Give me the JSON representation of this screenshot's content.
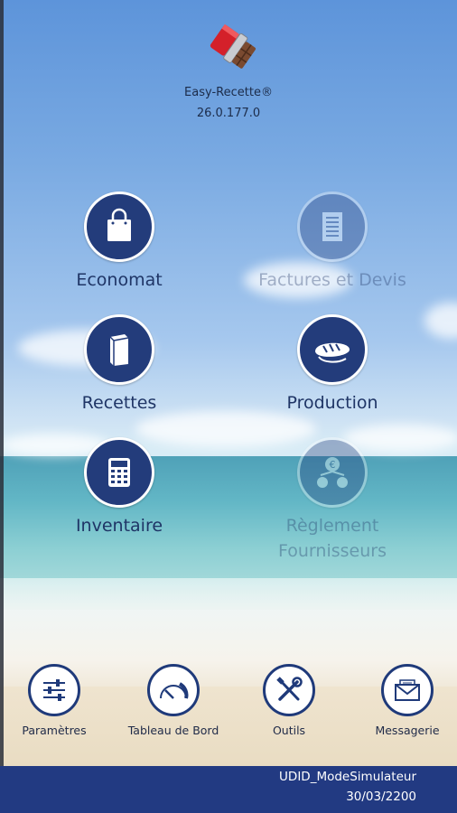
{
  "app": {
    "name": "Easy-Recette®",
    "version": "26.0.177.0"
  },
  "tiles": [
    {
      "label": "Economat",
      "icon": "shopping-bag-icon",
      "enabled": true
    },
    {
      "label": "Factures et Devis",
      "icon": "document-icon",
      "enabled": false
    },
    {
      "label": "Recettes",
      "icon": "book-icon",
      "enabled": true
    },
    {
      "label": "Production",
      "icon": "bread-icon",
      "enabled": true
    },
    {
      "label": "Inventaire",
      "icon": "calculator-icon",
      "enabled": true
    },
    {
      "label_line1": "Règlement",
      "label_line2": "Fournisseurs",
      "icon": "money-bags-icon",
      "enabled": false
    }
  ],
  "bottom_bar": [
    {
      "label": "Paramètres",
      "icon": "sliders-icon"
    },
    {
      "label": "Tableau de Bord",
      "icon": "gauge-icon"
    },
    {
      "label": "Outils",
      "icon": "tools-icon"
    },
    {
      "label": "Messagerie",
      "icon": "mail-icon"
    }
  ],
  "footer": {
    "line1": "UDID_ModeSimulateur",
    "line2": "30/03/2200"
  },
  "colors": {
    "accent": "#233c7b",
    "footer_bg": "#223a82",
    "label": "#1f3566"
  }
}
